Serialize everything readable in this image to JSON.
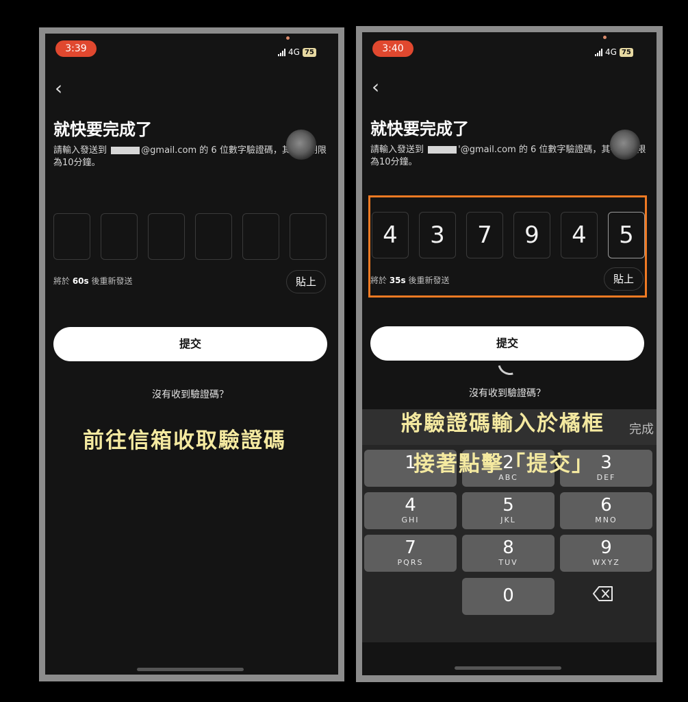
{
  "colors": {
    "highlight": "#f07a23",
    "caption": "#f4e9a0",
    "time_pill": "#e0482f"
  },
  "left": {
    "status": {
      "time": "3:39",
      "network": "4G",
      "battery": "75"
    },
    "title": "就快要完成了",
    "subtitle_before": "請輸入發送到",
    "subtitle_after": "@gmail.com 的 6 位數字驗證碼，其有效期限為10分鐘。",
    "otp": [
      "",
      "",
      "",
      "",
      "",
      ""
    ],
    "resend_prefix": "將於 ",
    "resend_count": "60s",
    "resend_suffix": " 後重新發送",
    "paste_label": "貼上",
    "submit_label": "提交",
    "no_code_label": "沒有收到驗證碼？",
    "caption": "前往信箱收取驗證碼"
  },
  "right": {
    "status": {
      "time": "3:40",
      "network": "4G",
      "battery": "75"
    },
    "title": "就快要完成了",
    "subtitle_before": "請輸入發送到",
    "subtitle_after": "'@gmail.com 的 6 位數字驗證碼，其有效期限為10分鐘。",
    "otp": [
      "4",
      "3",
      "7",
      "9",
      "4",
      "5"
    ],
    "resend_prefix": "將於 ",
    "resend_count": "35s",
    "resend_suffix": " 後重新發送",
    "paste_label": "貼上",
    "submit_label": "提交",
    "no_code_label": "沒有收到驗證碼？",
    "caption_line1": "將驗證碼輸入於橘框",
    "caption_line2": "接著點擊「提交」",
    "keyboard": {
      "done_label": "完成",
      "keys": [
        {
          "num": "1",
          "letters": ""
        },
        {
          "num": "2",
          "letters": "ABC"
        },
        {
          "num": "3",
          "letters": "DEF"
        },
        {
          "num": "4",
          "letters": "GHI"
        },
        {
          "num": "5",
          "letters": "JKL"
        },
        {
          "num": "6",
          "letters": "MNO"
        },
        {
          "num": "7",
          "letters": "PQRS"
        },
        {
          "num": "8",
          "letters": "TUV"
        },
        {
          "num": "9",
          "letters": "WXYZ"
        },
        {
          "num": "0",
          "letters": ""
        }
      ],
      "delete_icon": "backspace-icon"
    }
  }
}
